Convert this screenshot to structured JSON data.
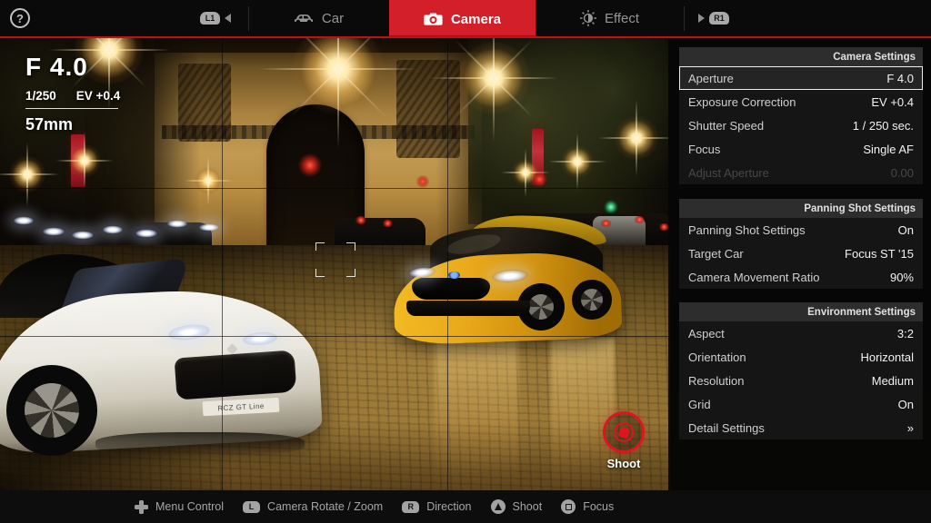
{
  "topbar": {
    "help": "?",
    "l1": "L1",
    "r1": "R1",
    "tabs": [
      {
        "label": "Car",
        "icon": "car-icon",
        "active": false
      },
      {
        "label": "Camera",
        "icon": "camera-icon",
        "active": true
      },
      {
        "label": "Effect",
        "icon": "effect-icon",
        "active": false
      }
    ]
  },
  "viewport_hud": {
    "aperture": "F 4.0",
    "shutter_speed": "1/250",
    "exposure": "EV +0.4",
    "focal_length": "57mm",
    "shoot_button": "Shoot"
  },
  "scene": {
    "license_plate": "RCZ GT Line"
  },
  "panels": [
    {
      "title": "Camera Settings",
      "rows": [
        {
          "label": "Aperture",
          "value": "F 4.0",
          "state": "selected"
        },
        {
          "label": "Exposure Correction",
          "value": "EV +0.4",
          "state": "normal"
        },
        {
          "label": "Shutter Speed",
          "value": "1 / 250 sec.",
          "state": "normal"
        },
        {
          "label": "Focus",
          "value": "Single AF",
          "state": "normal"
        },
        {
          "label": "Adjust Aperture",
          "value": "0.00",
          "state": "disabled"
        }
      ]
    },
    {
      "title": "Panning Shot Settings",
      "rows": [
        {
          "label": "Panning Shot Settings",
          "value": "On",
          "state": "normal"
        },
        {
          "label": "Target Car",
          "value": "Focus ST '15",
          "state": "normal"
        },
        {
          "label": "Camera Movement Ratio",
          "value": "90%",
          "state": "normal"
        }
      ]
    },
    {
      "title": "Environment Settings",
      "rows": [
        {
          "label": "Aspect",
          "value": "3:2",
          "state": "normal"
        },
        {
          "label": "Orientation",
          "value": "Horizontal",
          "state": "normal"
        },
        {
          "label": "Resolution",
          "value": "Medium",
          "state": "normal"
        },
        {
          "label": "Grid",
          "value": "On",
          "state": "normal"
        },
        {
          "label": "Detail Settings",
          "value": "»",
          "state": "normal"
        }
      ]
    }
  ],
  "bottom_bar": [
    {
      "icon": "dpad-icon",
      "badge": "",
      "label": "Menu Control"
    },
    {
      "icon": "left-stick-icon",
      "badge": "L",
      "label": "Camera Rotate / Zoom"
    },
    {
      "icon": "right-stick-icon",
      "badge": "R",
      "label": "Direction"
    },
    {
      "icon": "triangle-button-icon",
      "badge": "",
      "label": "Shoot"
    },
    {
      "icon": "square-button-icon",
      "badge": "",
      "label": "Focus"
    }
  ],
  "colors": {
    "accent_red": "#d31f29",
    "underline_red": "#c11016",
    "panel_header": "#2d2d2d",
    "panel_body": "#151515"
  }
}
